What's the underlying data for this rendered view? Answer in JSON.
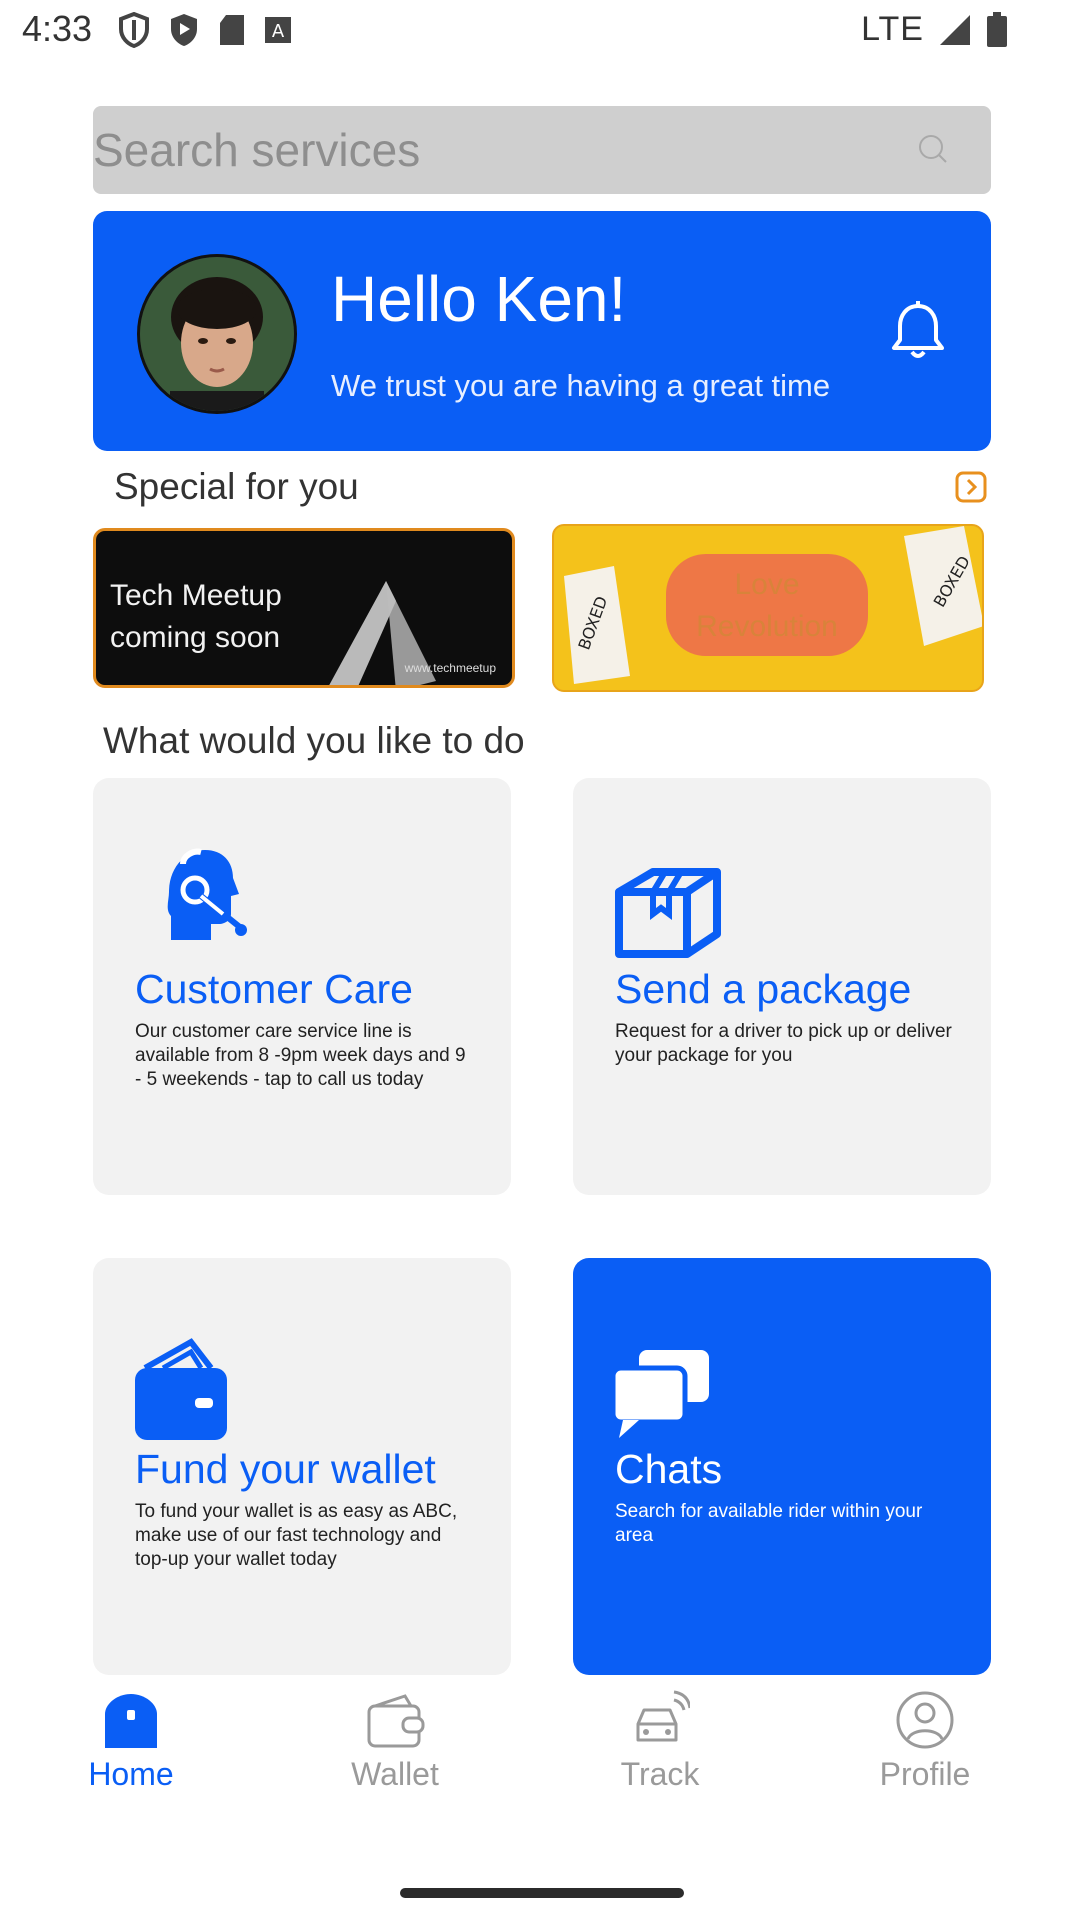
{
  "status_bar": {
    "time": "4:33",
    "network": "LTE"
  },
  "search": {
    "placeholder": "Search services"
  },
  "greeting": {
    "title": "Hello Ken!",
    "subtitle": "We trust you are having a great time"
  },
  "special": {
    "title": "Special for you",
    "promos": [
      {
        "text_line1": "Tech Meetup",
        "text_line2": "coming soon",
        "small": "www.techmeetup"
      },
      {
        "text_line1": "Love",
        "text_line2": "Revolution"
      }
    ]
  },
  "todo": {
    "title": "What would you like to do",
    "cards": [
      {
        "title": "Customer Care",
        "description": "Our customer care service line is available from 8 -9pm week days and 9 - 5 weekends - tap to call us today",
        "icon": "headset-icon"
      },
      {
        "title": "Send a package",
        "description": "Request for a driver to pick up or deliver your package for you",
        "icon": "package-icon"
      },
      {
        "title": "Fund your wallet",
        "description": "To fund your wallet is as easy as ABC, make use of our fast technology and top-up your wallet today",
        "icon": "wallet-icon"
      },
      {
        "title": "Chats",
        "description": "Search for available rider within your area",
        "icon": "chat-icon"
      }
    ]
  },
  "nav": {
    "items": [
      {
        "label": "Home",
        "icon": "home-icon",
        "active": true
      },
      {
        "label": "Wallet",
        "icon": "wallet-icon",
        "active": false
      },
      {
        "label": "Track",
        "icon": "car-icon",
        "active": false
      },
      {
        "label": "Profile",
        "icon": "profile-icon",
        "active": false
      }
    ]
  },
  "colors": {
    "accent": "#0a5ef5",
    "card_bg": "#f2f2f2",
    "muted": "#9a9a9a",
    "promo_border": "#e08a1e"
  }
}
